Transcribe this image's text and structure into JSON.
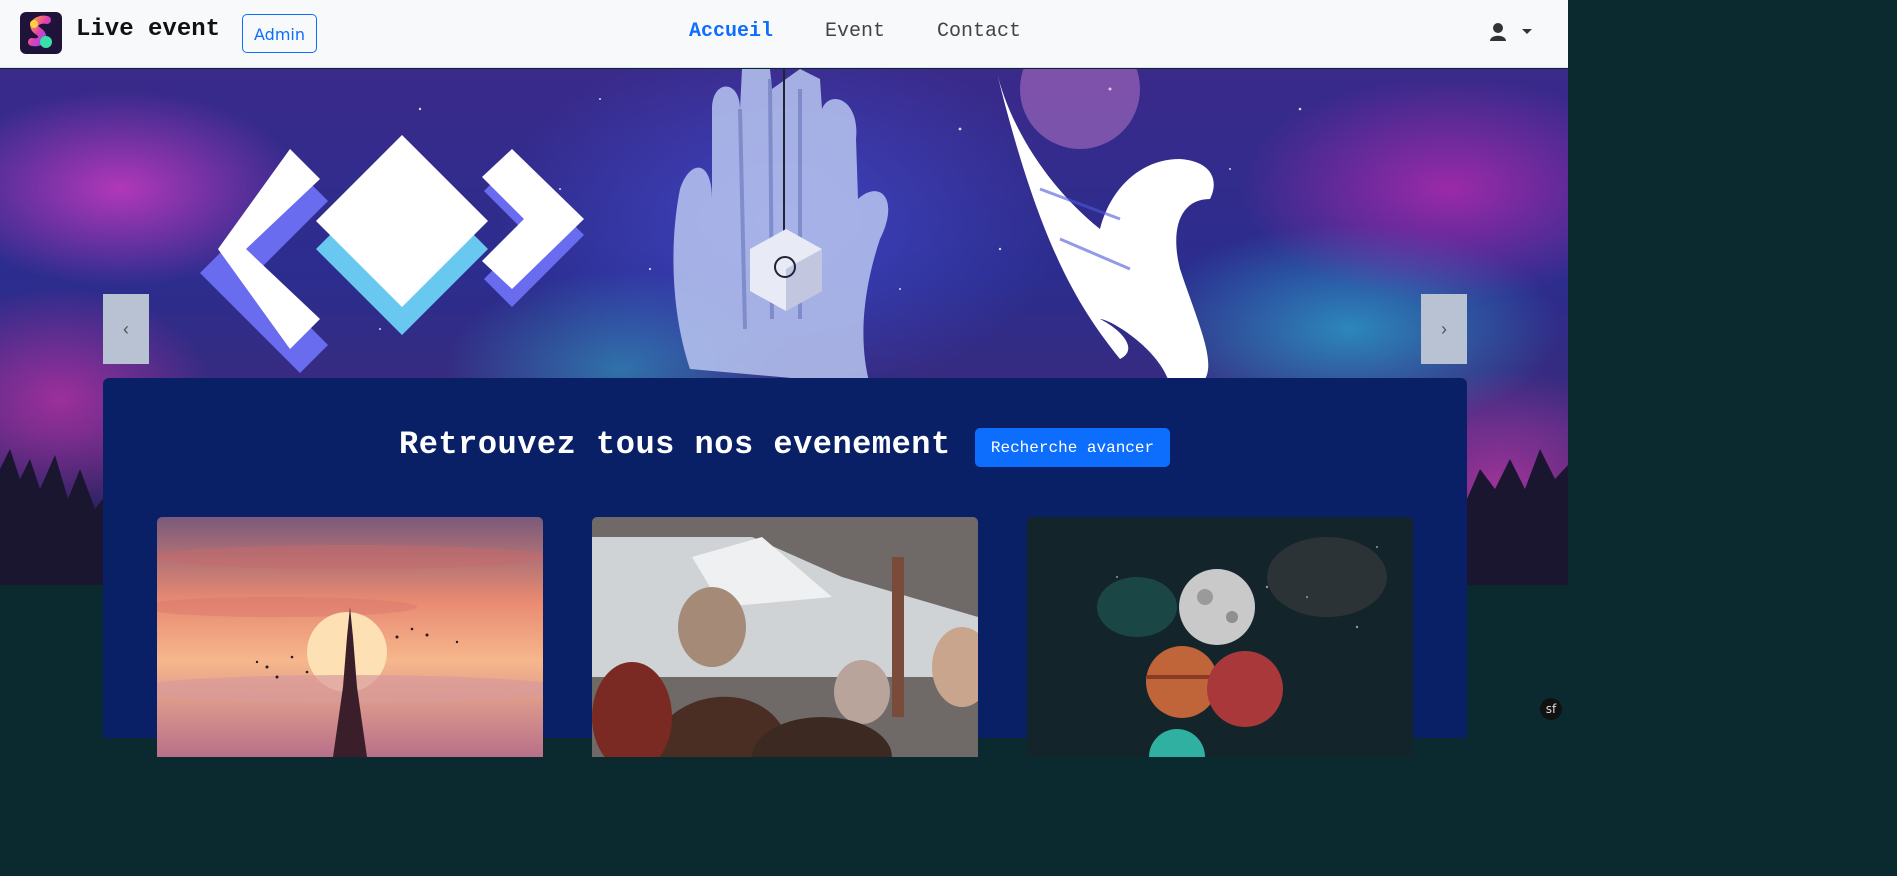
{
  "navbar": {
    "brand_title": "Live event",
    "admin_label": "Admin",
    "links": [
      {
        "label": "Accueil",
        "active": true
      },
      {
        "label": "Event",
        "active": false
      },
      {
        "label": "Contact",
        "active": false
      }
    ],
    "user_icon": "user-icon",
    "dropdown_icon": "caret-down-icon"
  },
  "main": {
    "title": "Retrouvez tous nos evenement",
    "search_button": "Recherche avancer",
    "cards": [
      {
        "image": "eiffel-tower-sunset"
      },
      {
        "image": "crowd-festival"
      },
      {
        "image": "planets-balloons"
      }
    ],
    "prev_icon": "chevron-left-icon",
    "next_icon": "chevron-right-icon"
  },
  "colors": {
    "accent": "#0d6efd",
    "panel": "#0a2066",
    "navbar": "#f8f9fa"
  }
}
